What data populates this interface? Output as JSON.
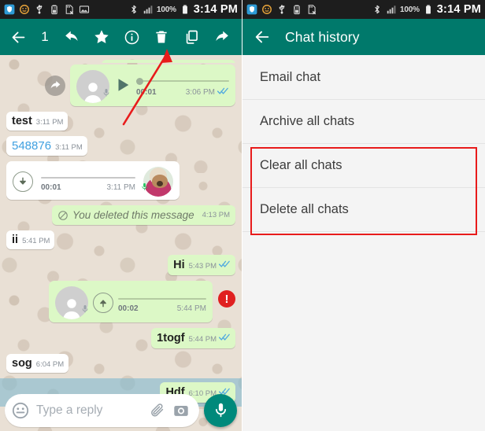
{
  "status_bar": {
    "icons": [
      "shield-icon",
      "smiley-icon",
      "usb-icon",
      "battery-saver-icon",
      "sd-card-error-icon",
      "image-icon"
    ],
    "icons_right_panel": [
      "shield-icon",
      "smiley-icon",
      "usb-icon",
      "battery-saver-icon",
      "sd-card-error-icon"
    ],
    "bluetooth": "bluetooth-icon",
    "signal": "signal-bars-icon",
    "battery_percent": "100%",
    "battery": "battery-icon",
    "time": "3:14 PM"
  },
  "left_panel": {
    "toolbar": {
      "back": "back-arrow-icon",
      "selection_count": "1",
      "reply": "reply-icon",
      "star": "star-icon",
      "info": "info-icon",
      "delete": "trash-icon",
      "copy": "copy-icon",
      "forward": "forward-icon"
    },
    "messages": [
      {
        "id": "voice-out-1",
        "type": "voice",
        "direction": "out",
        "forwarded": true,
        "duration": "00:01",
        "time": "3:06 PM",
        "status": "read",
        "control": "play-icon",
        "avatar": "contact-avatar"
      },
      {
        "id": "text-in-1",
        "type": "text",
        "direction": "in",
        "text": "test",
        "time": "3:11 PM"
      },
      {
        "id": "text-in-2",
        "type": "text",
        "direction": "in",
        "text": "548876",
        "time": "3:11 PM",
        "is_link": true
      },
      {
        "id": "voice-in-1",
        "type": "voice",
        "direction": "in",
        "duration": "00:01",
        "time": "3:11 PM",
        "control": "download-icon",
        "avatar": "dog-avatar"
      },
      {
        "id": "deleted-out-1",
        "type": "deleted",
        "direction": "out",
        "text": "You deleted this message",
        "time": "4:13 PM",
        "icon": "blocked-icon"
      },
      {
        "id": "text-in-3",
        "type": "text",
        "direction": "in",
        "text": "ii",
        "time": "5:41 PM"
      },
      {
        "id": "text-out-1",
        "type": "text",
        "direction": "out",
        "text": "Hi",
        "time": "5:43 PM",
        "status": "read"
      },
      {
        "id": "voice-out-2",
        "type": "voice",
        "direction": "out",
        "duration": "00:02",
        "time": "5:44 PM",
        "control": "upload-icon",
        "avatar": "contact-avatar",
        "error": "!"
      },
      {
        "id": "text-out-2",
        "type": "text",
        "direction": "out",
        "text": "1togf",
        "time": "5:44 PM",
        "status": "read"
      },
      {
        "id": "text-in-4",
        "type": "text",
        "direction": "in",
        "text": "sog",
        "time": "6:04 PM"
      },
      {
        "id": "text-out-3",
        "type": "text",
        "direction": "out",
        "text": "Hdf",
        "time": "6:10 PM",
        "status": "read",
        "selected": true
      }
    ],
    "input_bar": {
      "emoji": "emoji-icon",
      "placeholder": "Type a reply",
      "attach": "paperclip-icon",
      "camera": "camera-icon",
      "mic": "mic-icon"
    }
  },
  "right_panel": {
    "toolbar": {
      "back": "back-arrow-icon",
      "title": "Chat history"
    },
    "menu_items": [
      {
        "label": "Email chat",
        "highlighted": false
      },
      {
        "label": "Archive all chats",
        "highlighted": false
      },
      {
        "label": "Clear all chats",
        "highlighted": true
      },
      {
        "label": "Delete all chats",
        "highlighted": true
      }
    ]
  },
  "annotations": {
    "arrow_color": "#e81b1b",
    "highlight_box_color": "#e81b1b",
    "arrow_target": "trash-icon"
  },
  "colors": {
    "toolbar_teal": "#00796b",
    "fab_teal": "#00897b",
    "outgoing_bubble": "#dcf8c6",
    "incoming_bubble": "#ffffff",
    "chat_background": "#e9e0d5",
    "selection_blue": "#83b9cf",
    "tick_blue": "#4fa8e0",
    "error_red": "#e02020",
    "link_blue": "#3fa0e0"
  }
}
